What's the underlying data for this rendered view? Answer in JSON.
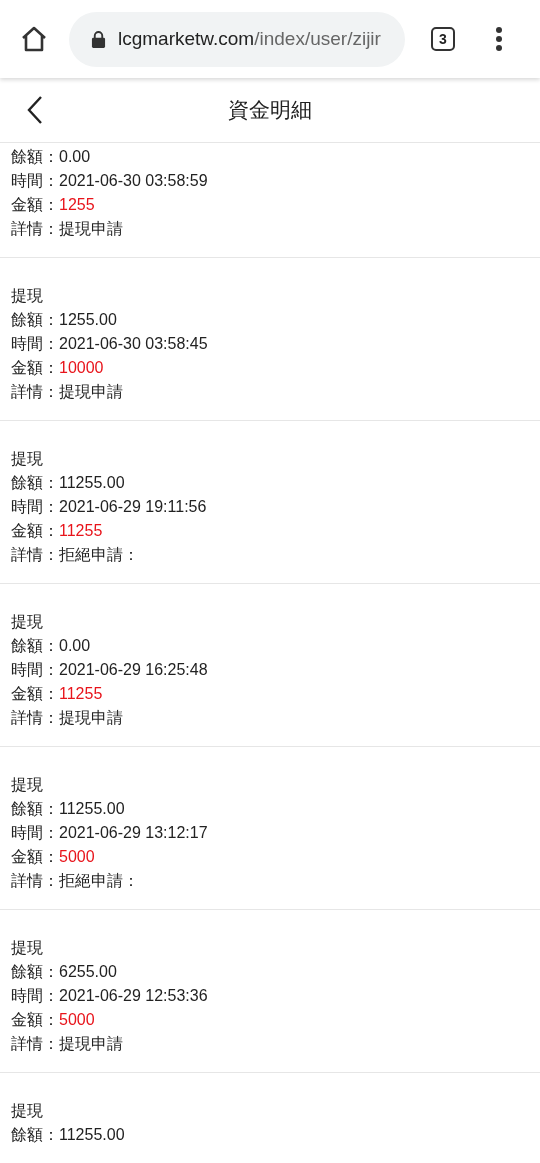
{
  "browser": {
    "url_host": "lcgmarketw.com",
    "url_path": "/index/user/zijir",
    "tab_count": "3"
  },
  "header": {
    "title": "資金明細"
  },
  "records": [
    {
      "lines": [
        {
          "kind": "plain",
          "label": "餘額：",
          "value": "0.00"
        },
        {
          "kind": "plain",
          "label": "時間：",
          "value": "2021-06-30 03:58:59"
        },
        {
          "kind": "amount",
          "label": "金額：",
          "value": "1255"
        },
        {
          "kind": "plain",
          "label": "詳情：",
          "value": "提現申請"
        }
      ]
    },
    {
      "title": "提現",
      "lines": [
        {
          "kind": "plain",
          "label": "餘額：",
          "value": "1255.00"
        },
        {
          "kind": "plain",
          "label": "時間：",
          "value": "2021-06-30 03:58:45"
        },
        {
          "kind": "amount",
          "label": "金額：",
          "value": "10000"
        },
        {
          "kind": "plain",
          "label": "詳情：",
          "value": "提現申請"
        }
      ]
    },
    {
      "title": "提現",
      "lines": [
        {
          "kind": "plain",
          "label": "餘額：",
          "value": "11255.00"
        },
        {
          "kind": "plain",
          "label": "時間：",
          "value": "2021-06-29 19:11:56"
        },
        {
          "kind": "amount",
          "label": "金額：",
          "value": "11255"
        },
        {
          "kind": "plain",
          "label": "詳情：",
          "value": "拒絕申請："
        }
      ]
    },
    {
      "title": "提現",
      "lines": [
        {
          "kind": "plain",
          "label": "餘額：",
          "value": "0.00"
        },
        {
          "kind": "plain",
          "label": "時間：",
          "value": "2021-06-29 16:25:48"
        },
        {
          "kind": "amount",
          "label": "金額：",
          "value": "11255"
        },
        {
          "kind": "plain",
          "label": "詳情：",
          "value": "提現申請"
        }
      ]
    },
    {
      "title": "提現",
      "lines": [
        {
          "kind": "plain",
          "label": "餘額：",
          "value": "11255.00"
        },
        {
          "kind": "plain",
          "label": "時間：",
          "value": "2021-06-29 13:12:17"
        },
        {
          "kind": "amount",
          "label": "金額：",
          "value": "5000"
        },
        {
          "kind": "plain",
          "label": "詳情：",
          "value": "拒絕申請："
        }
      ]
    },
    {
      "title": "提現",
      "lines": [
        {
          "kind": "plain",
          "label": "餘額：",
          "value": "6255.00"
        },
        {
          "kind": "plain",
          "label": "時間：",
          "value": "2021-06-29 12:53:36"
        },
        {
          "kind": "amount",
          "label": "金額：",
          "value": "5000"
        },
        {
          "kind": "plain",
          "label": "詳情：",
          "value": "提現申請"
        }
      ]
    },
    {
      "title": "提現",
      "lines": [
        {
          "kind": "plain",
          "label": "餘額：",
          "value": "11255.00"
        }
      ]
    }
  ]
}
